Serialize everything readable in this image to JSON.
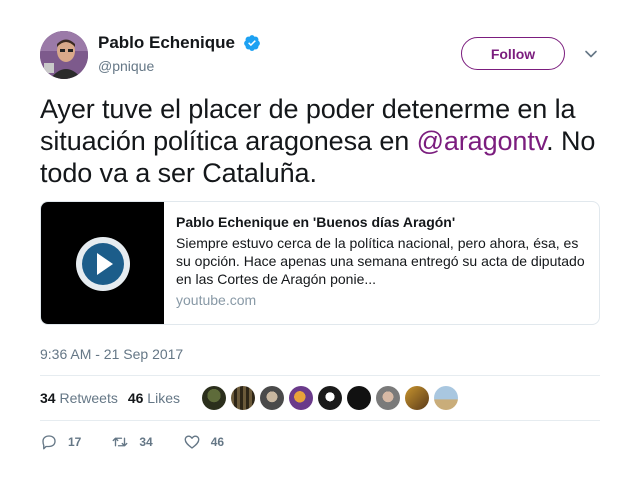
{
  "user": {
    "display_name": "Pablo Echenique",
    "handle": "@pnique",
    "verified": true
  },
  "follow_label": "Follow",
  "tweet": {
    "text_before": "Ayer tuve el placer de poder detenerme en la situación política aragonesa en ",
    "mention": "@aragontv",
    "text_after": ". No todo va a ser Cataluña."
  },
  "card": {
    "title": "Pablo Echenique en 'Buenos días Aragón'",
    "description": "Siempre estuvo cerca de la política nacional, pero ahora, ésa, es su opción. Hace apenas una semana entregó su acta de diputado en las Cortes de Aragón ponie...",
    "domain": "youtube.com"
  },
  "timestamp": "9:36 AM - 21 Sep 2017",
  "stats": {
    "retweets_count": "34",
    "retweets_label": "Retweets",
    "likes_count": "46",
    "likes_label": "Likes"
  },
  "actions": {
    "reply_count": "17",
    "retweet_count": "34",
    "like_count": "46"
  },
  "colors": {
    "accent": "#7b1d7e",
    "verified": "#1da1f2",
    "muted": "#657786"
  },
  "icons": [
    "verified-badge-icon",
    "chevron-down-icon",
    "play-icon",
    "reply-icon",
    "retweet-icon",
    "heart-icon"
  ]
}
